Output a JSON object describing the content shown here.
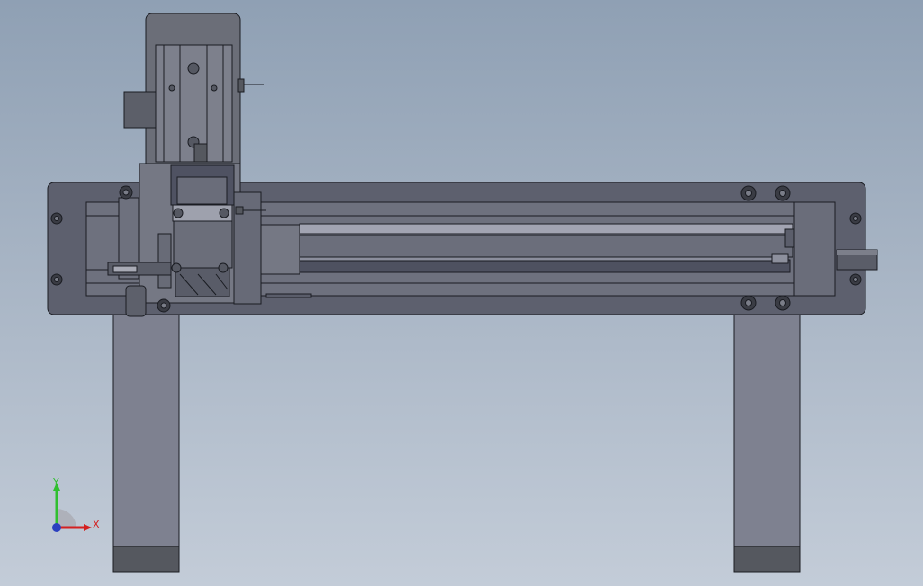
{
  "view": {
    "background_top": "#8fa0b4",
    "background_bottom": "#c3ccd8",
    "model_stroke": "#1a1c22"
  },
  "triad": {
    "y_label": "Y",
    "x_label": "X",
    "y_color": "#2fbf2f",
    "x_color": "#d42020",
    "z_color": "#2a3fbf"
  },
  "palette": {
    "frame_dark": "#5d606e",
    "frame_mid": "#6e717e",
    "frame_light": "#7d808c",
    "leg": "#7e8190",
    "leg_foot": "#55585f",
    "rail_light": "#a2a4b2",
    "bolt": "#3a3c44"
  }
}
